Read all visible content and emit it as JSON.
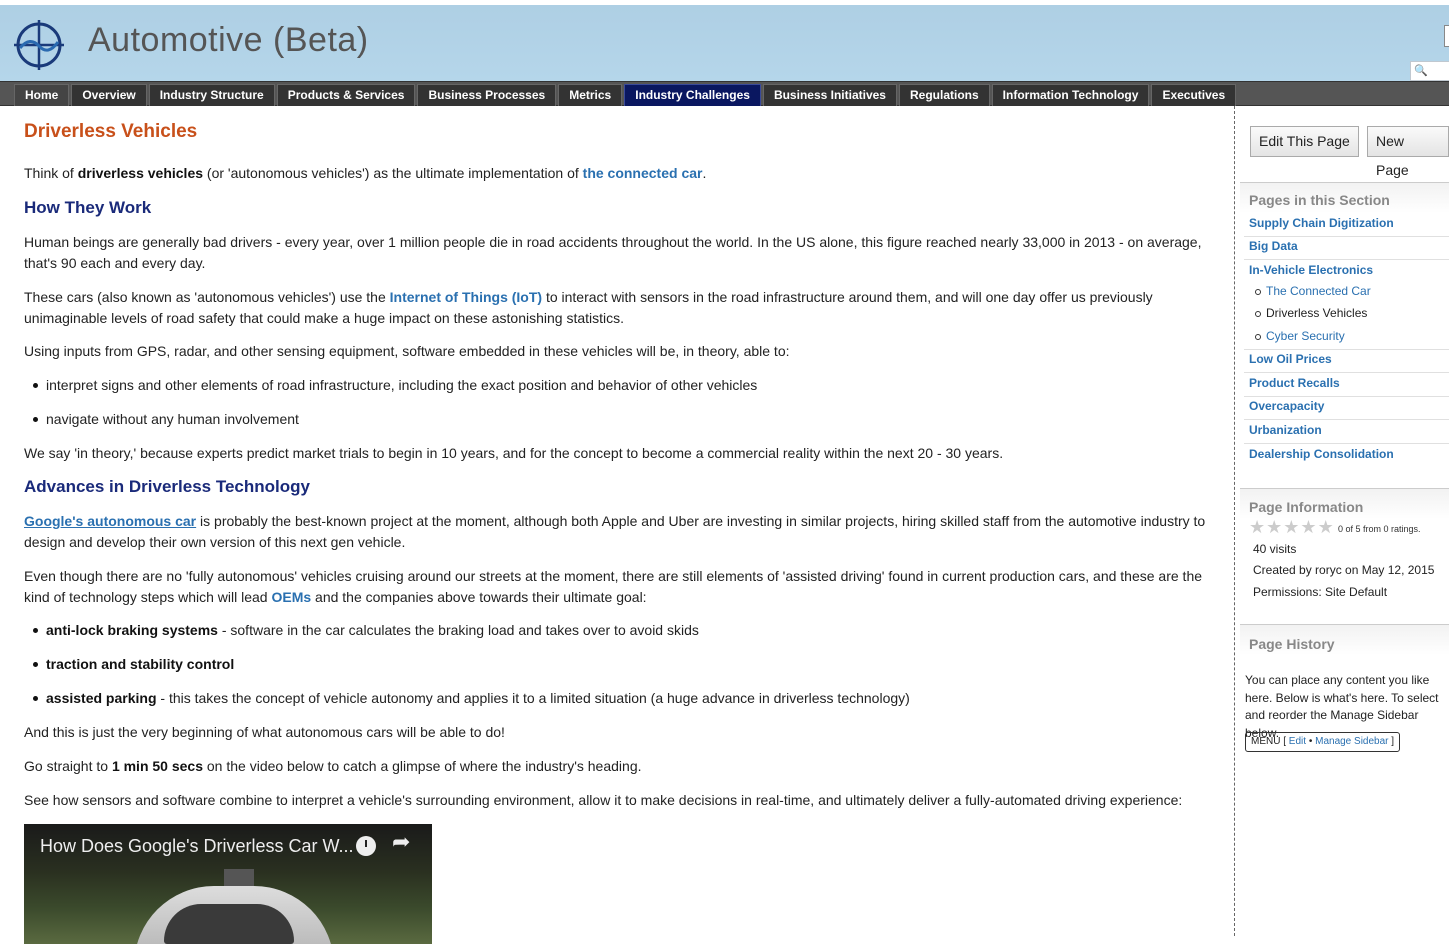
{
  "site": {
    "title": "Automotive (Beta)"
  },
  "nav": {
    "items": [
      "Home",
      "Overview",
      "Industry Structure",
      "Products & Services",
      "Business Processes",
      "Metrics",
      "Industry Challenges",
      "Business Initiatives",
      "Regulations",
      "Information Technology",
      "Executives"
    ],
    "active": "Industry Challenges"
  },
  "article": {
    "title": "Driverless Vehicles",
    "intro": {
      "pre": "Think of ",
      "bold": "driverless vehicles",
      "mid": " (or 'autonomous vehicles') as the ultimate implementation of ",
      "link": "the connected car",
      "post": "."
    },
    "h_how": "How They Work",
    "p_human": "Human beings are generally bad drivers - every year, over 1 million people die in road accidents throughout the world. In the US alone, this figure reached nearly 33,000 in 2013 - on average, that's 90 each and every day.",
    "p_cars": {
      "pre": "These cars (also known as 'autonomous vehicles') use the ",
      "link": "Internet of Things (IoT)",
      "post": " to interact with sensors in the road infrastructure around them, and will one day offer us previously unimaginable levels of road safety that could make a huge impact on these astonishing statistics."
    },
    "p_inputs": "Using inputs from GPS, radar, and other sensing equipment, software embedded in these vehicles will be, in theory, able to:",
    "bullets1": [
      "interpret signs and other elements of road infrastructure, including the exact position and behavior of other vehicles",
      "navigate without any human involvement"
    ],
    "p_theory": "We say 'in theory,' because experts predict market trials to begin in 10 years, and for the concept to become a commercial reality within the next 20 - 30 years.",
    "h_adv": "Advances in Driverless Technology",
    "p_google": {
      "link": "Google's autonomous car",
      "post": " is probably the best-known project at the moment, although both Apple and Uber are investing in similar projects, hiring skilled staff from the automotive industry to design and develop their own version of this next gen vehicle."
    },
    "p_even": {
      "pre": "Even though there are no 'fully autonomous' vehicles cruising around our streets at the moment, there are still elements of 'assisted driving' found in current production cars, and these are the kind of technology steps which will lead ",
      "link": "OEMs",
      "post": " and the companies above towards their ultimate goal:"
    },
    "bullets2": [
      {
        "bold": "anti-lock braking systems",
        "text": " - software in the car calculates the braking load and takes over to avoid skids"
      },
      {
        "bold": "traction and stability control",
        "text": ""
      },
      {
        "bold": "assisted parking",
        "text": " - this takes the concept of vehicle autonomy and applies it to a limited situation (a huge advance in driverless technology)"
      }
    ],
    "p_begin": "And this is just the very beginning of what autonomous cars will be able to do!",
    "p_go": {
      "pre": "Go straight to ",
      "bold": "1 min 50 secs",
      "post": " on the video below to catch a glimpse of where the industry's heading."
    },
    "p_see": "See how sensors and software combine to interpret a vehicle's surrounding environment, allow it to make decisions in real-time, and ultimately deliver a fully-automated driving experience:",
    "video_title": "How Does Google's Driverless Car W..."
  },
  "sidebar": {
    "edit_button": "Edit This Page",
    "new_button": "New Page",
    "section_head": "Pages in this Section",
    "pages": [
      "Supply Chain Digitization",
      "Big Data",
      "In-Vehicle Electronics"
    ],
    "subpages": [
      "The Connected Car",
      "Driverless Vehicles",
      "Cyber Security"
    ],
    "pages2": [
      "Low Oil Prices",
      "Product Recalls",
      "Overcapacity",
      "Urbanization",
      "Dealership Consolidation"
    ],
    "info_head": "Page Information",
    "rating": {
      "text": "0 of 5 from 0 ratings.",
      "value": 0,
      "max": 5
    },
    "visits": "40 visits",
    "created": "Created by roryc on May 12, 2015",
    "permissions": "Permissions: Site Default",
    "history_head": "Page History",
    "history_text": "You can place any content you like here. Below is what's here. To select and reorder the Manage Sidebar below.",
    "menu": {
      "label": "MENU",
      "edit": "Edit",
      "sep": "•",
      "manage": "Manage Sidebar"
    }
  }
}
